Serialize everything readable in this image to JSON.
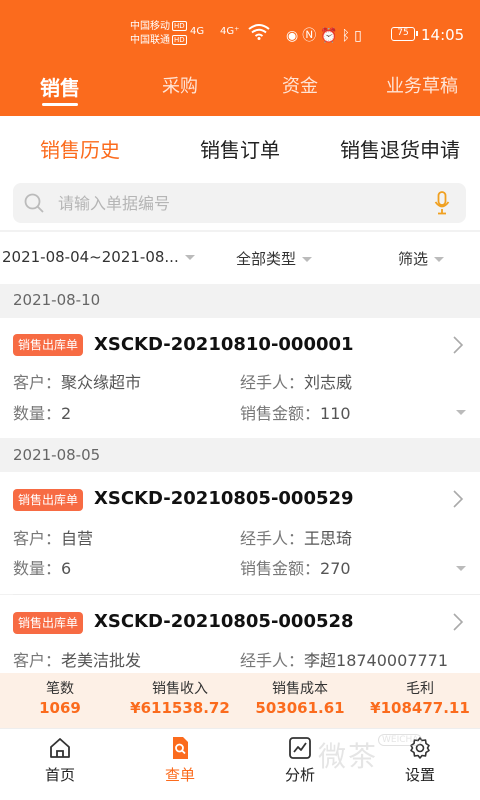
{
  "status_bar": {
    "carrier1": "中国移动",
    "carrier2": "中国联通",
    "hd": "HD",
    "sig1": "4G",
    "sig2": "4G⁺",
    "battery": "75",
    "time": "14:05"
  },
  "top_tabs": [
    {
      "label": "销售",
      "active": true
    },
    {
      "label": "采购",
      "active": false
    },
    {
      "label": "资金",
      "active": false
    },
    {
      "label": "业务草稿",
      "active": false
    }
  ],
  "sub_tabs": [
    {
      "label": "销售历史",
      "active": true
    },
    {
      "label": "销售订单",
      "active": false
    },
    {
      "label": "销售退货申请",
      "active": false
    }
  ],
  "search": {
    "placeholder": "请输入单据编号",
    "value": ""
  },
  "filters": {
    "date_range": "2021-08-04~2021-08...",
    "type": "全部类型",
    "screen": "筛选"
  },
  "groups": [
    {
      "date": "2021-08-10",
      "records": [
        {
          "badge": "销售出库单",
          "code": "XSCKD-20210810-000001",
          "customer_label": "客户：",
          "customer": "聚众缘超市",
          "handler_label": "经手人：",
          "handler": "刘志威",
          "qty_label": "数量：",
          "qty": "2",
          "amount_label": "销售金额：",
          "amount": "110"
        }
      ]
    },
    {
      "date": "2021-08-05",
      "records": [
        {
          "badge": "销售出库单",
          "code": "XSCKD-20210805-000529",
          "customer_label": "客户：",
          "customer": "自营",
          "handler_label": "经手人：",
          "handler": "王思琦",
          "qty_label": "数量：",
          "qty": "6",
          "amount_label": "销售金额：",
          "amount": "270"
        },
        {
          "badge": "销售出库单",
          "code": "XSCKD-20210805-000528",
          "customer_label": "客户：",
          "customer": "老美洁批发",
          "handler_label": "经手人：",
          "handler": "李超18740007771"
        }
      ]
    }
  ],
  "summary": [
    {
      "label": "笔数",
      "value": "1069"
    },
    {
      "label": "销售收入",
      "value": "¥611538.72"
    },
    {
      "label": "销售成本",
      "value": "503061.61"
    },
    {
      "label": "毛利",
      "value": "¥108477.11"
    }
  ],
  "bottom_nav": [
    {
      "label": "首页",
      "icon": "home-icon",
      "active": false
    },
    {
      "label": "查单",
      "icon": "search-doc-icon",
      "active": true
    },
    {
      "label": "分析",
      "icon": "chart-icon",
      "active": false
    },
    {
      "label": "设置",
      "icon": "gear-icon",
      "active": false
    }
  ],
  "colors": {
    "accent": "#fb6b1d",
    "badge": "#f76b43",
    "summary_bg": "#fdf0e6"
  }
}
